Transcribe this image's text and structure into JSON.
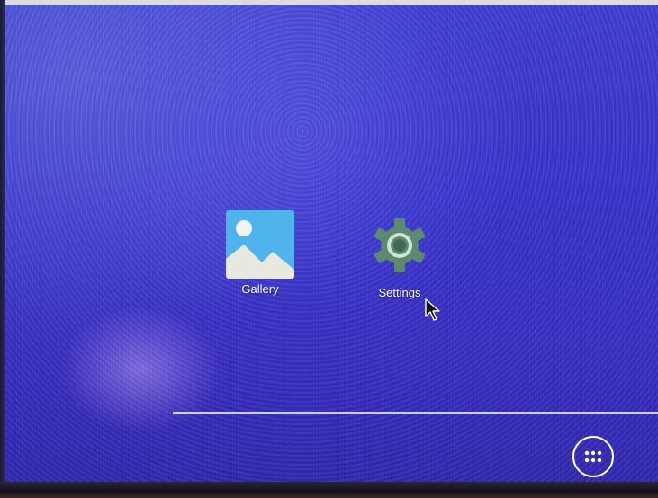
{
  "desktop": {
    "apps": [
      {
        "label": "Gallery",
        "icon": "gallery-icon"
      },
      {
        "label": "Settings",
        "icon": "gear-icon"
      }
    ],
    "all_apps_icon": "apps-grid-icon",
    "cursor_icon": "mouse-pointer-icon"
  },
  "colors": {
    "wallpaper": "#3a34d0",
    "gallery_sky": "#4fb3ec",
    "gallery_sun": "#f2f2f2",
    "gallery_mountains": "#e8e8e0",
    "settings_gear": "#5d8a6e",
    "settings_ring": "#cfe3d3",
    "label_text": "#ffffff"
  }
}
